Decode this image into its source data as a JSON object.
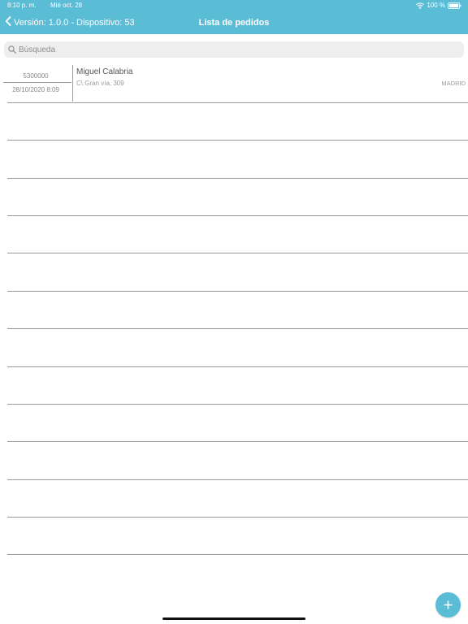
{
  "status_bar": {
    "time": "8:10 p. m.",
    "date": "Mié oct. 28",
    "battery": "100 %"
  },
  "nav": {
    "back_label": "Versión: 1.0.0 - Dispositivo: 53",
    "title": "Lista de pedidos"
  },
  "search": {
    "placeholder": "Búsqueda",
    "value": ""
  },
  "orders": [
    {
      "number": "5300000",
      "datetime": "28/10/2020 8:09",
      "customer": "Miguel Calabria",
      "address": "C\\ Gran vía, 309",
      "city": "MADRID"
    }
  ],
  "icons": {
    "back": "chevron-left-icon",
    "search": "search-icon",
    "wifi": "wifi-icon",
    "battery": "battery-icon",
    "add": "plus-icon"
  },
  "colors": {
    "accent": "#5bbcd6",
    "separator": "#9a9a9a",
    "search_background": "#eeeeef"
  }
}
